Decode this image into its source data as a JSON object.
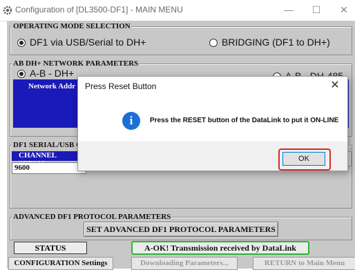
{
  "window": {
    "title": "Configuration of [DL3500-DF1] - MAIN MENU",
    "minimize_glyph": "—",
    "maximize_glyph": "☐",
    "close_glyph": "✕"
  },
  "operating_mode": {
    "label": "OPERATING MODE SELECTION",
    "options": [
      "DF1 via USB/Serial to DH+",
      "BRIDGING (DF1 to DH+)"
    ],
    "selected_index": 0
  },
  "ab_dh": {
    "label": "AB DH+ NETWORK PARAMETERS",
    "option_left": "A-B - DH+",
    "option_right": "A-B - DH-485",
    "network_address_label": "Network Addr"
  },
  "df1_serial": {
    "label": "DF1 SERIAL/USB C",
    "channel_label": "CHANNEL SERIAL",
    "baud_value": "9600"
  },
  "advanced": {
    "label": "ADVANCED DF1 PROTOCOL PARAMETERS",
    "button_label": "SET ADVANCED DF1 PROTOCOL PARAMETERS"
  },
  "status": {
    "label": "STATUS",
    "value": "A-OK! Transmission received by DataLink",
    "value_border_color": "#2bb52b"
  },
  "bottom_buttons": [
    "CONFIGURATION Settings",
    "Downloading Parameters...",
    "RETURN to Main Menu"
  ],
  "dialog": {
    "title": "Press Reset Button",
    "message": "Press the RESET button of the DataLink to put it ON-LINE",
    "ok_label": "OK",
    "icon": "info-icon",
    "highlight_color": "#d42a2a"
  }
}
